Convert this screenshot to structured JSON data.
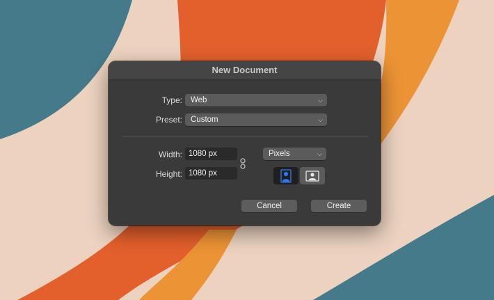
{
  "dialog": {
    "title": "New Document",
    "type_label": "Type:",
    "type_value": "Web",
    "preset_label": "Preset:",
    "preset_value": "Custom",
    "width_label": "Width:",
    "width_value": "1080 px",
    "height_label": "Height:",
    "height_value": "1080 px",
    "units_value": "Pixels",
    "cancel_label": "Cancel",
    "create_label": "Create"
  },
  "colors": {
    "wallpaper_teal": "#457a8a",
    "wallpaper_cream": "#ecd2bf",
    "wallpaper_orange": "#e3602c",
    "wallpaper_amber": "#ec9335",
    "accent_blue": "#2f7cf6"
  },
  "icons": {
    "dropdown": "chevron-down-icon",
    "link": "chain-link-icon",
    "portrait": "portrait-orientation-icon",
    "landscape": "landscape-orientation-icon"
  }
}
